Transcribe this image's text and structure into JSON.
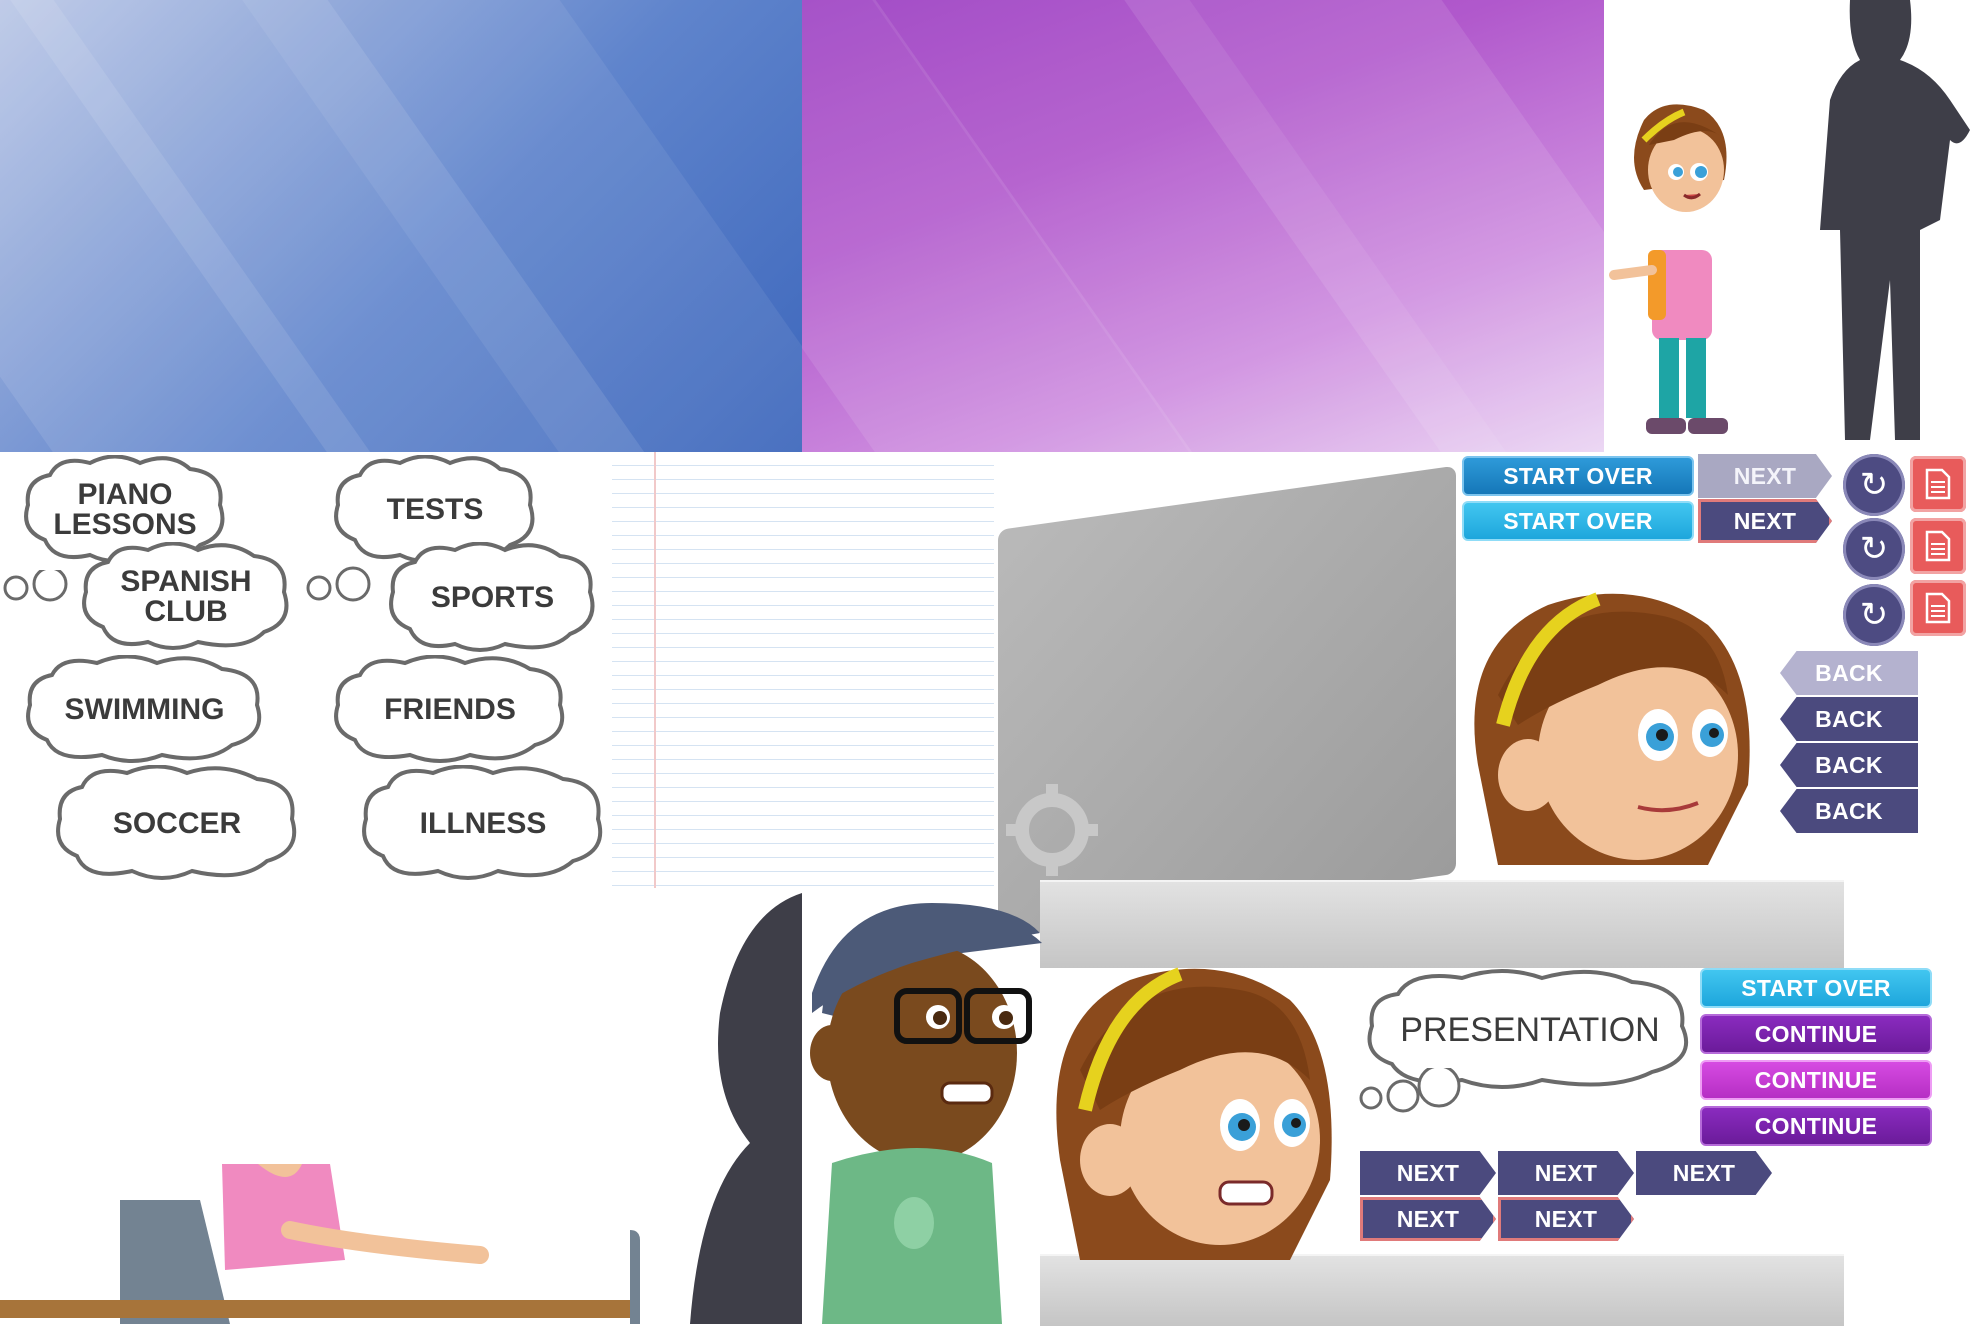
{
  "bubbles": [
    {
      "label": "PIANO\nLESSONS"
    },
    {
      "label": "TESTS"
    },
    {
      "label": "SPANISH\nCLUB"
    },
    {
      "label": "SPORTS"
    },
    {
      "label": "SWIMMING"
    },
    {
      "label": "FRIENDS"
    },
    {
      "label": "SOCCER"
    },
    {
      "label": "ILLNESS"
    },
    {
      "label": "PRESENTATION"
    }
  ],
  "buttons": {
    "start_over": "START OVER",
    "next": "NEXT",
    "back": "BACK",
    "continue": "CONTINUE"
  },
  "icons": {
    "replay": "replay-icon",
    "document": "document-icon"
  },
  "colors": {
    "navy_button": "#4b4a7e",
    "purple_button": "#6b1b9a",
    "magenta_button": "#b62ec4",
    "blue_button": "#1577b8",
    "cyan_button": "#1ea6dc",
    "red_doc_button": "#e85b5b"
  }
}
